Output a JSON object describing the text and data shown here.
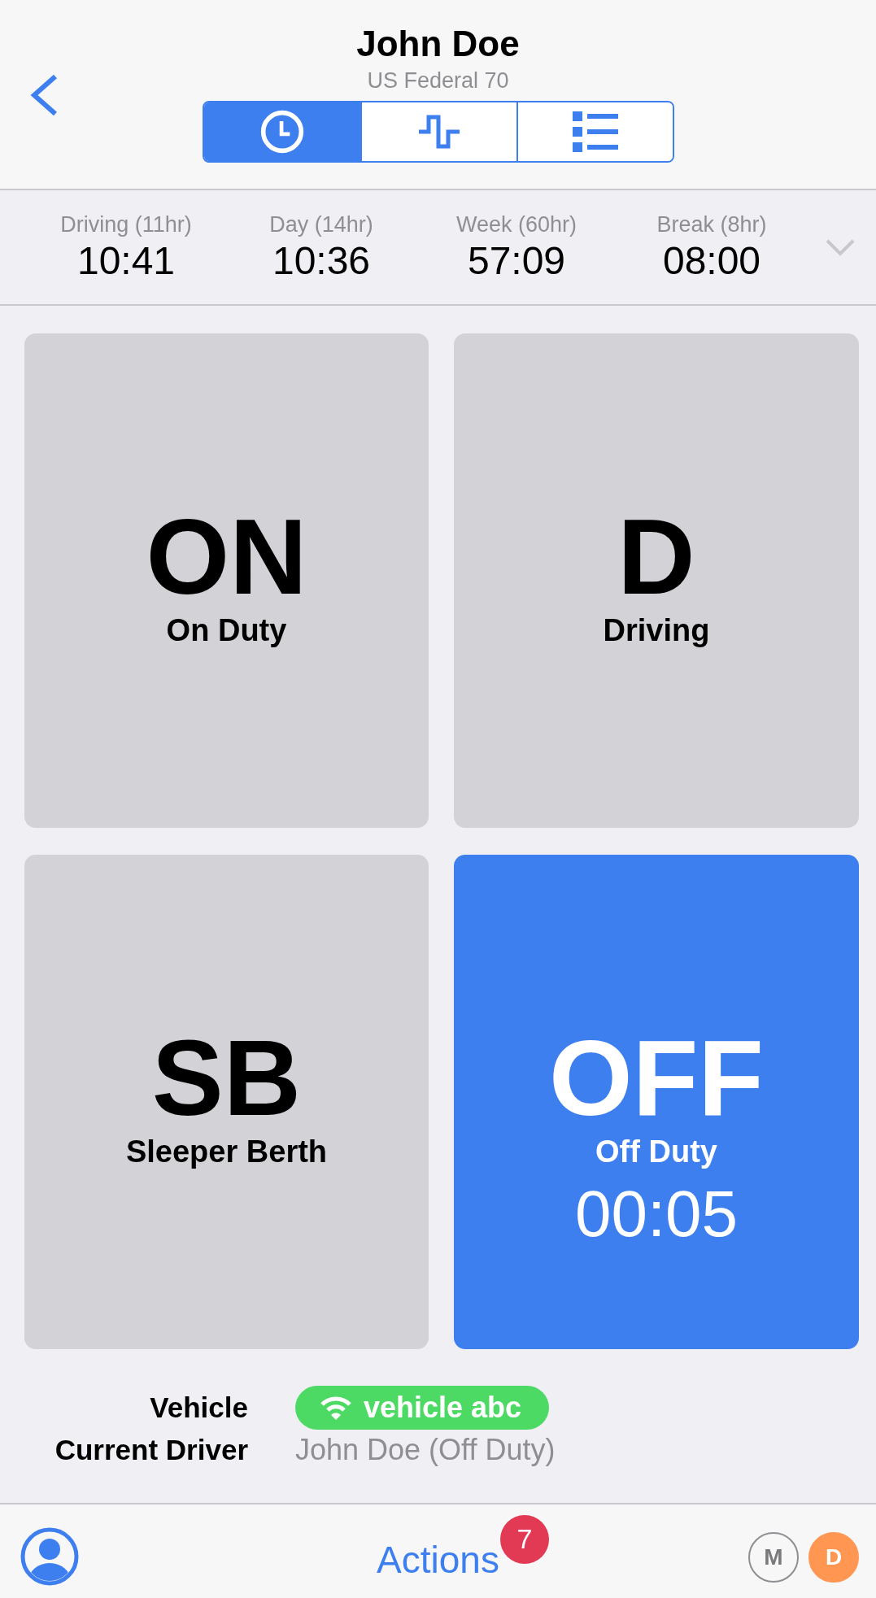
{
  "header": {
    "title": "John Doe",
    "subtitle": "US Federal 70"
  },
  "view_tabs": [
    {
      "kind": "clock",
      "selected": true
    },
    {
      "kind": "graph",
      "selected": false
    },
    {
      "kind": "list",
      "selected": false
    }
  ],
  "clocks": [
    {
      "label": "Driving (11hr)",
      "value": "10:41"
    },
    {
      "label": "Day (14hr)",
      "value": "10:36"
    },
    {
      "label": "Week (60hr)",
      "value": "57:09"
    },
    {
      "label": "Break (8hr)",
      "value": "08:00"
    }
  ],
  "statuses": [
    {
      "code": "ON",
      "label": "On Duty",
      "selected": false
    },
    {
      "code": "D",
      "label": "Driving",
      "selected": false
    },
    {
      "code": "SB",
      "label": "Sleeper Berth",
      "selected": false
    },
    {
      "code": "OFF",
      "label": "Off Duty",
      "selected": true,
      "timer": "00:05"
    }
  ],
  "vehicle": {
    "label": "Vehicle",
    "value": "vehicle abc",
    "connected": true
  },
  "current_driver": {
    "label": "Current Driver",
    "value": "John Doe (Off Duty)"
  },
  "bottom_bar": {
    "actions": "Actions",
    "badge": "7",
    "indicators": [
      {
        "letter": "M",
        "kind": "outline"
      },
      {
        "letter": "D",
        "kind": "filled"
      }
    ]
  }
}
